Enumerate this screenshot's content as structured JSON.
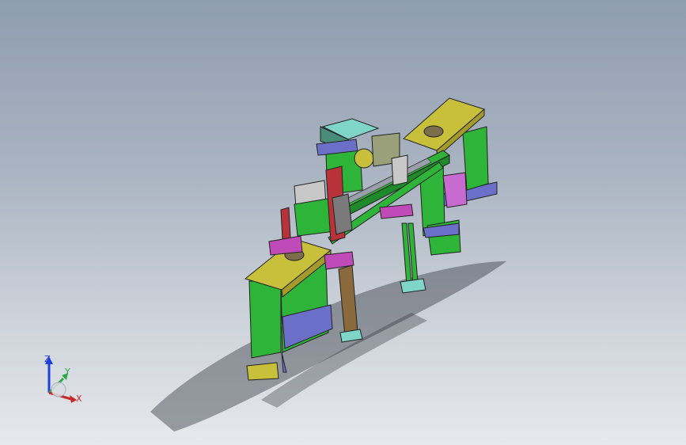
{
  "viewport": {
    "background_top": "#8f9db1",
    "background_bottom": "#e6e9ed"
  },
  "model": {
    "part_colors": {
      "frame_green": "#2fb43a",
      "plate_yellow": "#c8bf3a",
      "base_purple": "#6c6fc8",
      "bracket_magenta": "#c04ab8",
      "arm_red": "#b8323a",
      "column_brown": "#8a6a3c",
      "foot_cyan": "#7fd6c8"
    }
  },
  "triad": {
    "z_label": "Z",
    "y_label": "Y",
    "x_label": "X",
    "z_color": "#1f3fd6",
    "y_color": "#2fa84a",
    "x_color": "#c82a2a"
  }
}
